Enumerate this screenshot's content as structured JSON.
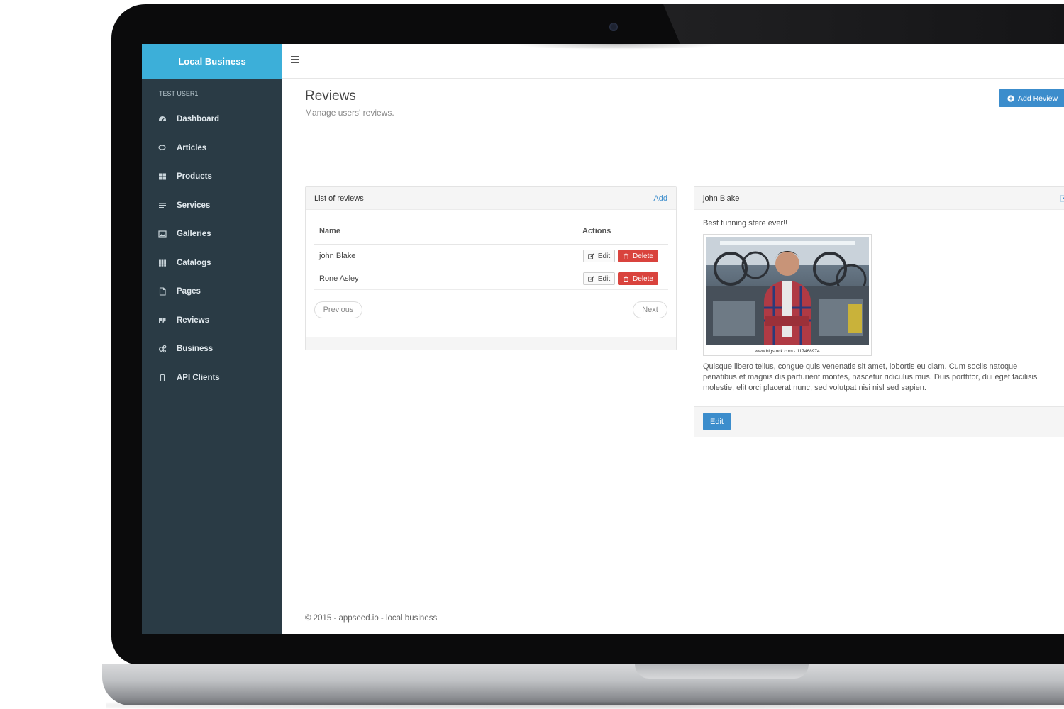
{
  "sidebar": {
    "brand": "Local Business",
    "user": "TEST USER1",
    "items": [
      {
        "label": "Dashboard",
        "icon": "dashboard-icon"
      },
      {
        "label": "Articles",
        "icon": "comments-icon"
      },
      {
        "label": "Products",
        "icon": "grid-icon"
      },
      {
        "label": "Services",
        "icon": "list-icon"
      },
      {
        "label": "Galleries",
        "icon": "image-icon"
      },
      {
        "label": "Catalogs",
        "icon": "th-icon"
      },
      {
        "label": "Pages",
        "icon": "file-icon"
      },
      {
        "label": "Reviews",
        "icon": "quote-icon"
      },
      {
        "label": "Business",
        "icon": "gears-icon"
      },
      {
        "label": "API Clients",
        "icon": "mobile-icon"
      }
    ]
  },
  "header": {
    "title": "Reviews",
    "subtitle": "Manage users' reviews.",
    "add_review_label": "Add Review"
  },
  "reviews_list": {
    "title": "List of reviews",
    "add_label": "Add",
    "columns": {
      "name": "Name",
      "actions": "Actions"
    },
    "rows": [
      {
        "name": "john Blake",
        "edit": "Edit",
        "delete": "Delete"
      },
      {
        "name": "Rone Asley",
        "edit": "Edit",
        "delete": "Delete"
      }
    ],
    "previous_label": "Previous",
    "next_label": "Next"
  },
  "review_detail": {
    "author": "john Blake",
    "title": "Best tunning stere ever!!",
    "image_caption": "www.bigstock.com · 117468974",
    "body": "Quisque libero tellus, congue quis venenatis sit amet, lobortis eu diam. Cum sociis natoque penatibus et magnis dis parturient montes, nascetur ridiculus mus. Duis porttitor, dui eget facilisis molestie, elit orci placerat nunc, sed volutpat nisi nisl sed sapien.",
    "edit_label": "Edit"
  },
  "footer": {
    "text": "© 2015 - appseed.io - local business"
  },
  "colors": {
    "brand": "#3cafd9",
    "sidebar": "#2a3b45",
    "primary": "#3c8dcc",
    "danger": "#d9433d"
  }
}
